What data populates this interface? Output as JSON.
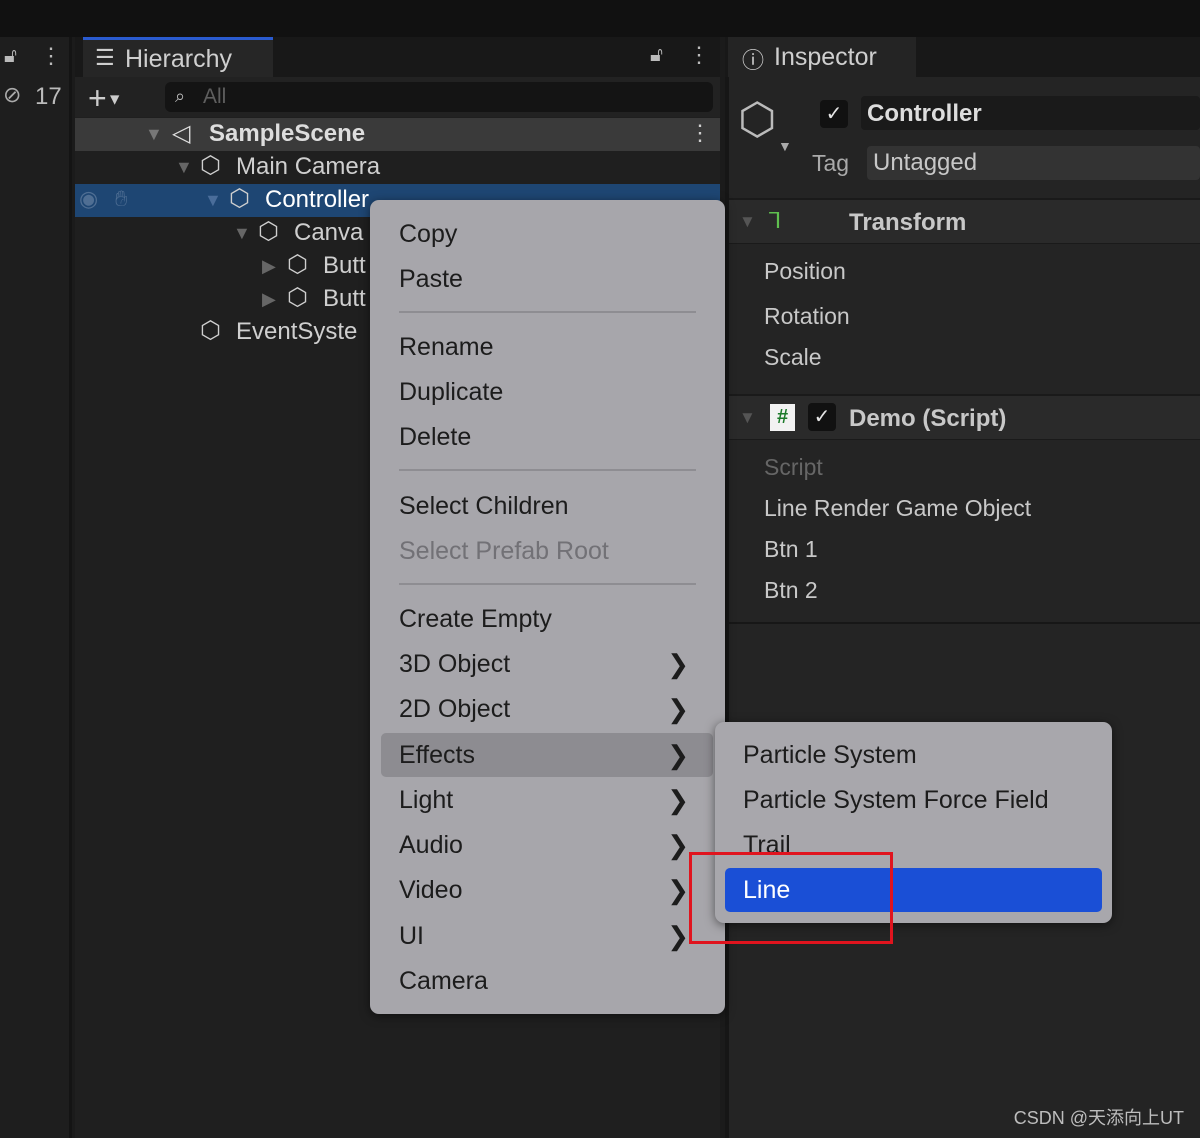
{
  "left_strip": {
    "hidden_count": "17"
  },
  "hierarchy": {
    "tab_label": "Hierarchy",
    "search_placeholder": "All",
    "items": [
      {
        "label": "SampleScene"
      },
      {
        "label": "Main Camera"
      },
      {
        "label": "Controller"
      },
      {
        "label": "Canva"
      },
      {
        "label": "Butt"
      },
      {
        "label": "Butt"
      },
      {
        "label": "EventSyste"
      }
    ]
  },
  "inspector": {
    "tab_label": "Inspector",
    "object_name": "Controller",
    "tag_label": "Tag",
    "tag_value": "Untagged",
    "transform": {
      "title": "Transform",
      "fields": [
        "Position",
        "Rotation",
        "Scale"
      ]
    },
    "script": {
      "title": "Demo (Script)",
      "fields": [
        "Script",
        "Line Render Game Object",
        "Btn 1",
        "Btn 2"
      ]
    }
  },
  "context_menu": {
    "items": [
      "Copy",
      "Paste",
      "Rename",
      "Duplicate",
      "Delete",
      "Select Children",
      "Select Prefab Root",
      "Create Empty",
      "3D Object",
      "2D Object",
      "Effects",
      "Light",
      "Audio",
      "Video",
      "UI",
      "Camera"
    ],
    "highlighted": "Effects"
  },
  "submenu": {
    "items": [
      "Particle System",
      "Particle System Force Field",
      "Trail",
      "Line"
    ],
    "selected": "Line",
    "accent": "#1a4fd6"
  },
  "annotation_color": "#e0141e",
  "watermark": "CSDN @天添向上UT"
}
